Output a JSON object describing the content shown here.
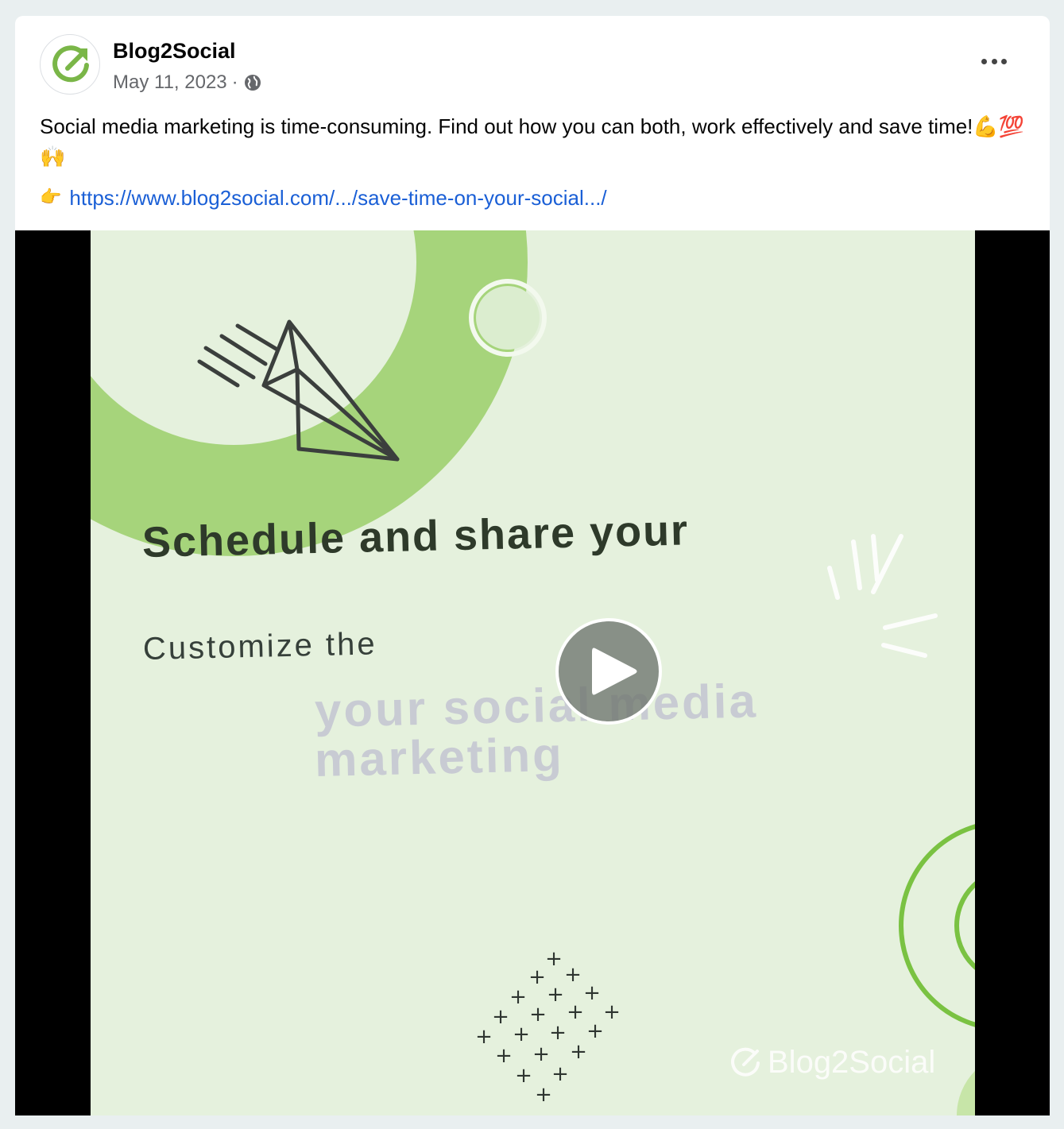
{
  "post": {
    "page_name": "Blog2Social",
    "date": "May 11, 2023",
    "separator": "·",
    "text": "Social media marketing is time-consuming. Find out how you can both, work effectively and save time!💪💯🙌",
    "link_emoji": "👉",
    "link_text": "https://www.blog2social.com/.../save-time-on-your-social.../"
  },
  "video": {
    "headline": "Schedule and share your",
    "subline": "Customize the",
    "ghost_line_1": "your social media",
    "ghost_line_2": "marketing",
    "watermark": "Blog2Social"
  },
  "icons": {
    "avatar": "blog2social-logo-icon",
    "audience": "globe-icon",
    "menu": "more-options-icon",
    "play": "play-icon"
  },
  "colors": {
    "brand_green": "#7ab648",
    "link_blue": "#1a5fd6",
    "video_background": "#e5f1dd"
  }
}
